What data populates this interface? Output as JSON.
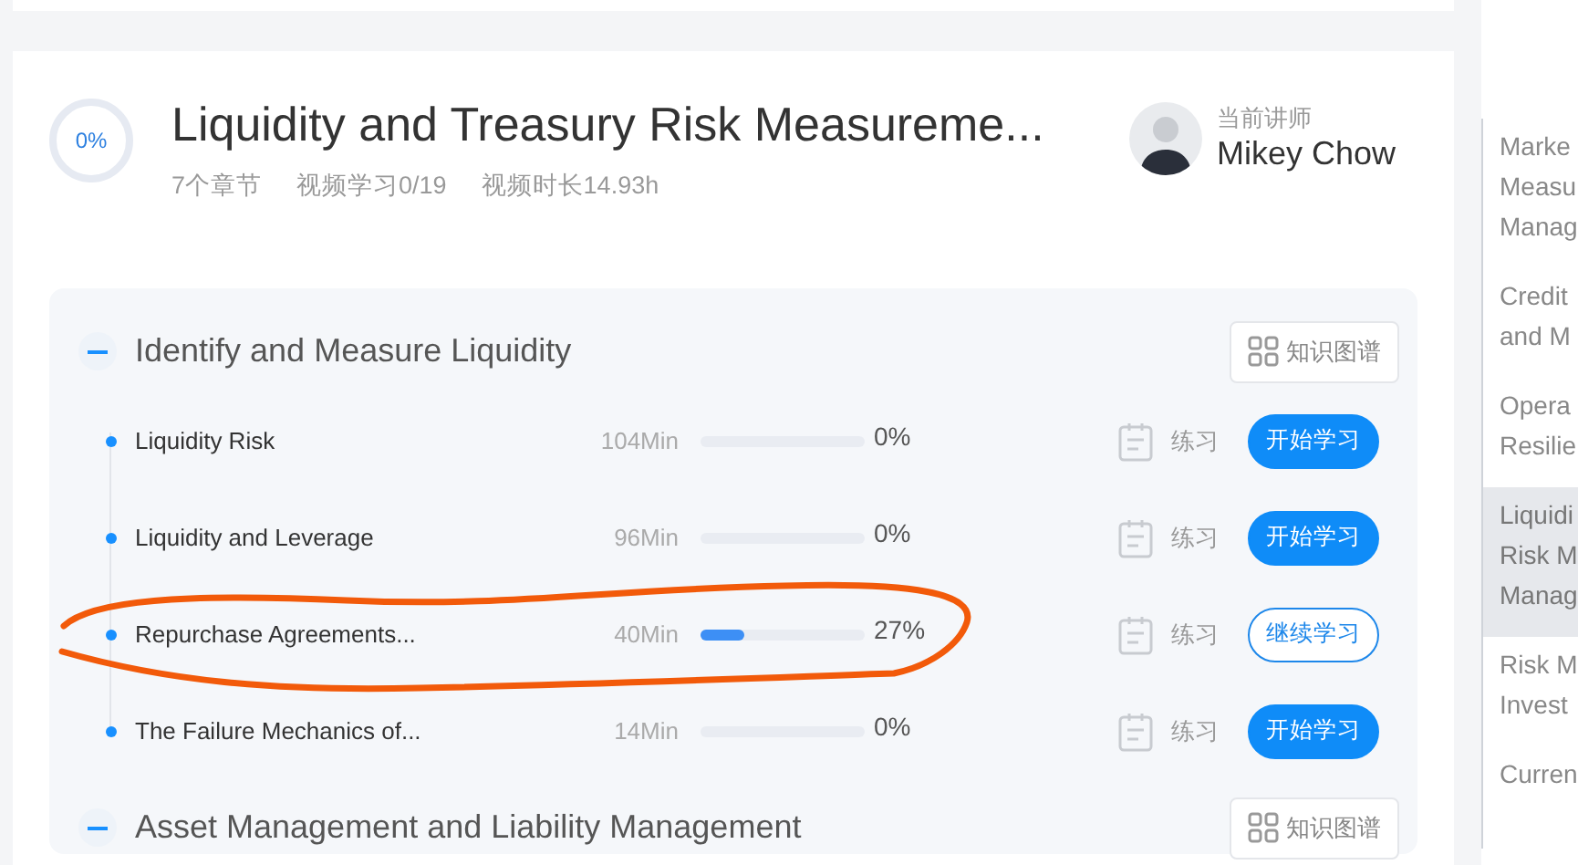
{
  "course": {
    "progress_label": "0%",
    "title": "Liquidity and Treasury Risk Measureme...",
    "meta": [
      "7个章节",
      "视频学习0/19",
      "视频时长14.93h"
    ],
    "instructor": {
      "caption": "当前讲师",
      "name": "Mikey Chow"
    }
  },
  "chapters": [
    {
      "title": "Identify and Measure Liquidity",
      "expanded": true,
      "map_button": "知识图谱",
      "lessons": [
        {
          "title": "Liquidity Risk",
          "minutes": "104Min",
          "level": 0,
          "percent": "0%",
          "practice": "练习",
          "button": "开始学习",
          "started": false,
          "circled": false
        },
        {
          "title": "Liquidity and Leverage",
          "minutes": "96Min",
          "level": 0,
          "percent": "0%",
          "practice": "练习",
          "button": "开始学习",
          "started": false,
          "circled": false
        },
        {
          "title": "Repurchase Agreements...",
          "minutes": "40Min",
          "level": 0.27,
          "percent": "27%",
          "practice": "练习",
          "button": "继续学习",
          "started": true,
          "circled": true
        },
        {
          "title": "The Failure Mechanics of...",
          "minutes": "14Min",
          "level": 0,
          "percent": "0%",
          "practice": "练习",
          "button": "开始学习",
          "started": false,
          "circled": false
        }
      ]
    },
    {
      "title": "Asset Management and Liability Management",
      "expanded": true,
      "map_button": "知识图谱"
    }
  ],
  "sidebar": {
    "items": [
      {
        "lines": [
          "Marke",
          "Measu",
          "Manag"
        ],
        "selected": false
      },
      {
        "lines": [
          "Credit",
          "and M"
        ],
        "selected": false
      },
      {
        "lines": [
          "Opera",
          "Resilie"
        ],
        "selected": false
      },
      {
        "lines": [
          "Liquidi",
          "Risk M",
          "Manag"
        ],
        "selected": true
      },
      {
        "lines": [
          "Risk M",
          "Invest"
        ],
        "selected": false
      },
      {
        "lines": [
          "Curren"
        ],
        "selected": false
      }
    ]
  }
}
